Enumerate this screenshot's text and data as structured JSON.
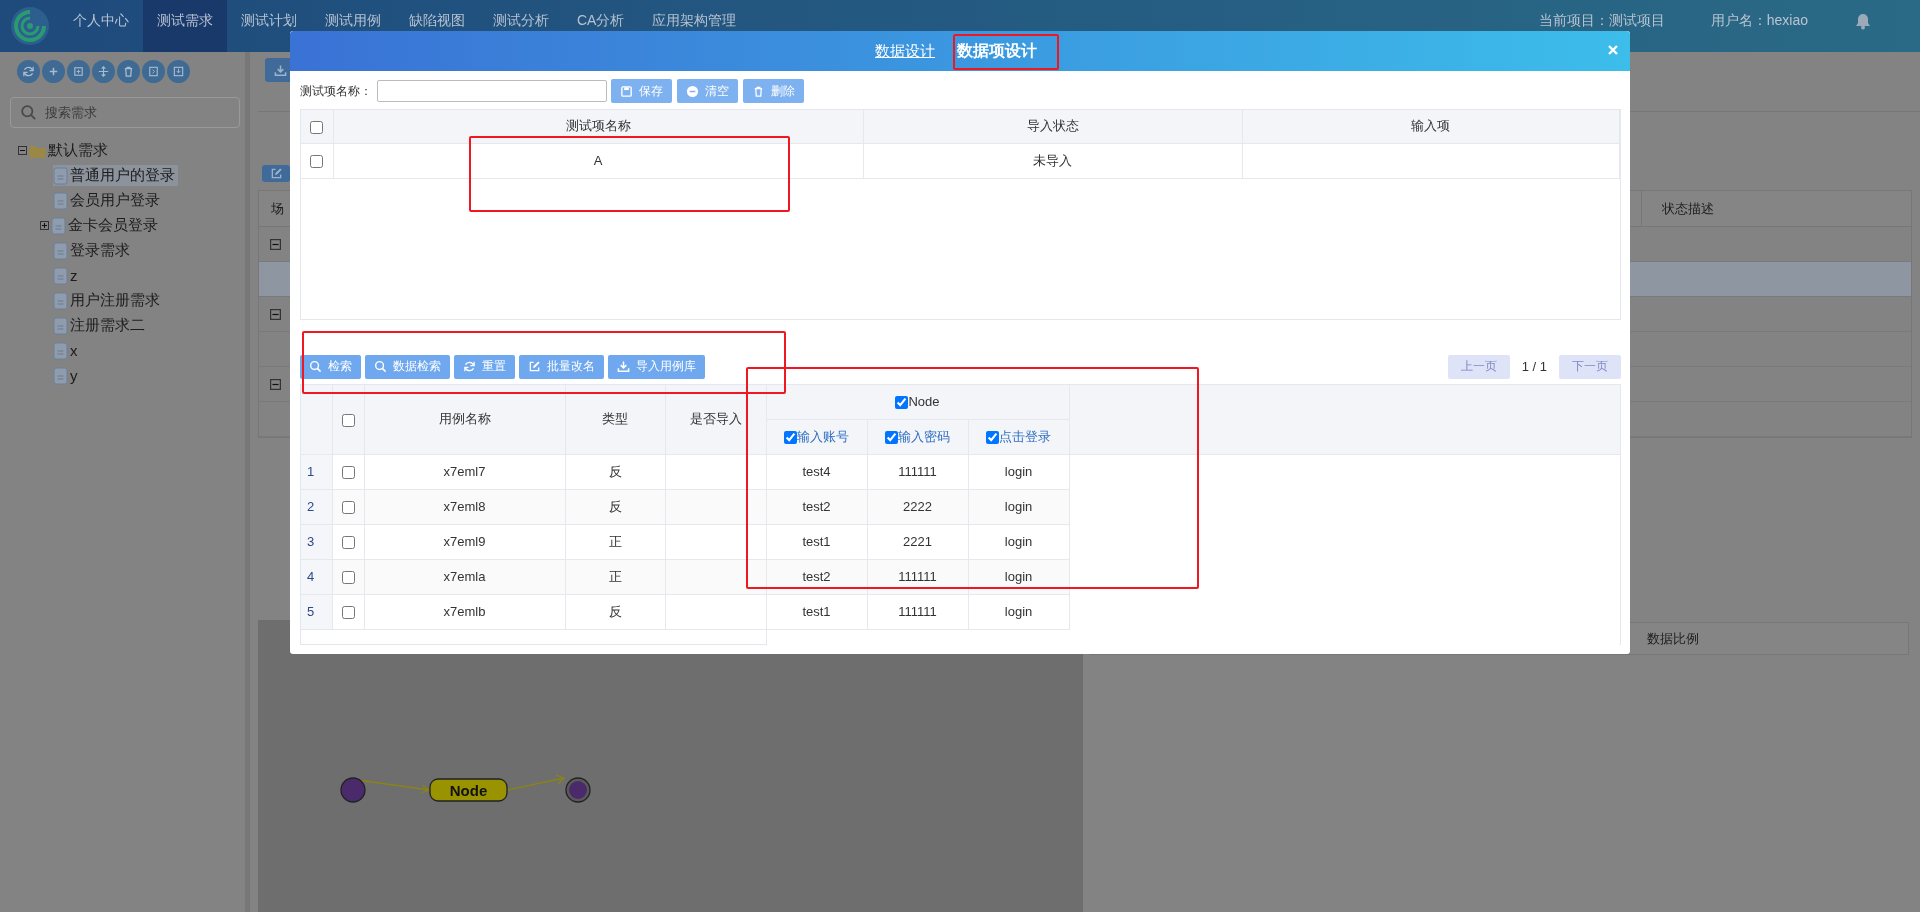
{
  "nav": {
    "items": [
      {
        "label": "个人中心",
        "selected": false
      },
      {
        "label": "测试需求",
        "selected": true
      },
      {
        "label": "测试计划",
        "selected": false
      },
      {
        "label": "测试用例",
        "selected": false
      },
      {
        "label": "缺陷视图",
        "selected": false
      },
      {
        "label": "测试分析",
        "selected": false
      },
      {
        "label": "CA分析",
        "selected": false
      },
      {
        "label": "应用架构管理",
        "selected": false
      }
    ],
    "project": "当前项目：测试项目",
    "user": "用户名：hexiao"
  },
  "sidebar": {
    "search": {
      "placeholder": "搜索需求"
    },
    "tree": [
      {
        "label": "默认需求",
        "expanded": true,
        "children": [
          {
            "label": "普通用户的登录",
            "selected": true
          },
          {
            "label": "会员用户登录",
            "selected": false
          },
          {
            "label": "金卡会员登录",
            "selected": false,
            "expanded": false
          },
          {
            "label": "登录需求",
            "selected": false
          },
          {
            "label": "z",
            "selected": false
          },
          {
            "label": "用户注册需求",
            "selected": false
          },
          {
            "label": "注册需求二",
            "selected": false
          },
          {
            "label": "x",
            "selected": false
          },
          {
            "label": "y",
            "selected": false
          }
        ]
      }
    ]
  },
  "main": {
    "table": {
      "column_1": "场",
      "status_header": "状态描述",
      "rows": [
        {
          "kind": "group",
          "expanded": true,
          "selected": false
        },
        {
          "kind": "item",
          "selected": true
        },
        {
          "kind": "group",
          "expanded": true,
          "selected": false
        },
        {
          "kind": "item",
          "selected": false
        },
        {
          "kind": "group",
          "expanded": true,
          "selected": false
        },
        {
          "kind": "item",
          "selected": false
        }
      ]
    },
    "diagram": {
      "node": "Node"
    },
    "ratio_header": "数据比例"
  },
  "dialog": {
    "tabs": [
      {
        "label": "数据设计",
        "selected": false
      },
      {
        "label": "数据项设计",
        "selected": true
      }
    ],
    "name_label": "测试项名称：",
    "form_buttons": [
      "保存",
      "清空",
      "删除"
    ],
    "items_table": {
      "header_checked": false,
      "columns": [
        "测试项名称",
        "导入状态",
        "输入项"
      ],
      "rows": [
        {
          "checked": false,
          "name": "A",
          "status": "未导入"
        }
      ]
    },
    "case_toolbar": [
      "检索",
      "数据检索",
      "重置",
      "批量改名",
      "导入用例库"
    ],
    "pagination": {
      "prev": "上一页",
      "page": "1 / 1",
      "next": "下一页",
      "prev_disabled": true,
      "next_disabled": true
    },
    "cases_table": {
      "header_checked": false,
      "columns": [
        "用例名称",
        "类型",
        "是否导入"
      ],
      "group": {
        "label": "Node",
        "checked": true,
        "columns": [
          {
            "label": "输入账号",
            "checked": true
          },
          {
            "label": "输入密码",
            "checked": true
          },
          {
            "label": "点击登录",
            "checked": true
          }
        ]
      },
      "rows": [
        {
          "index": "1",
          "checked": false,
          "name": "x7eml7",
          "type": "反",
          "values": [
            "test4",
            "111111",
            "login"
          ]
        },
        {
          "index": "2",
          "checked": false,
          "name": "x7eml8",
          "type": "反",
          "values": [
            "test2",
            "2222",
            "login"
          ]
        },
        {
          "index": "3",
          "checked": false,
          "name": "x7eml9",
          "type": "正",
          "values": [
            "test1",
            "2221",
            "login"
          ]
        },
        {
          "index": "4",
          "checked": false,
          "name": "x7emla",
          "type": "正",
          "values": [
            "test2",
            "111111",
            "login"
          ]
        },
        {
          "index": "5",
          "checked": false,
          "name": "x7emlb",
          "type": "反",
          "values": [
            "test1",
            "111111",
            "login"
          ]
        }
      ]
    }
  }
}
